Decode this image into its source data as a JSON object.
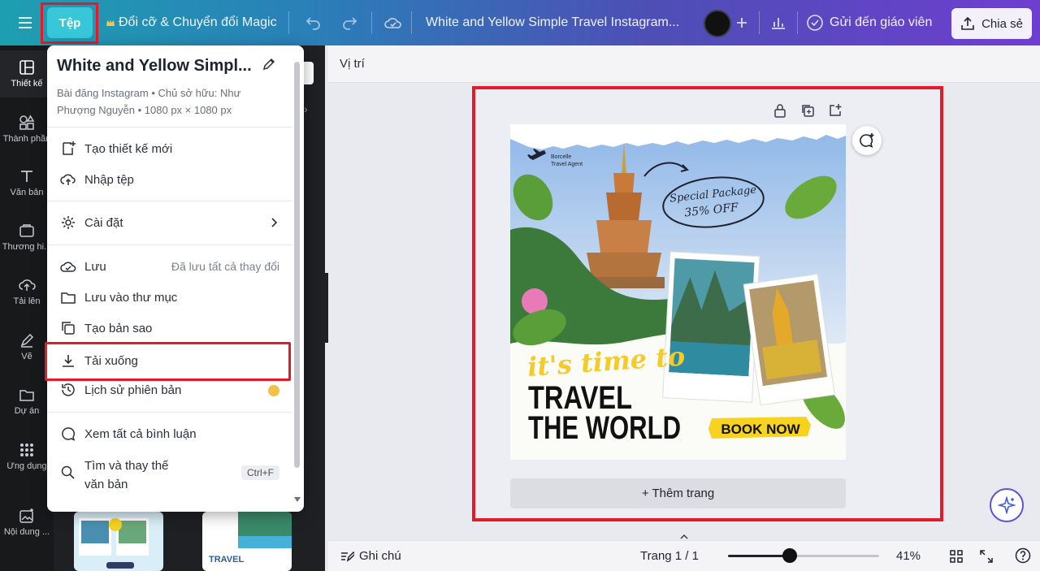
{
  "topbar": {
    "menu_icon": "hamburger-icon",
    "file_label": "Tệp",
    "resize_label": "Đổi cỡ & Chuyển đổi Magic",
    "undo_icon": "undo-icon",
    "redo_icon": "redo-icon",
    "cloud_icon": "cloud-check-icon",
    "design_title": "White and Yellow Simple Travel Instagram...",
    "send_teacher_label": "Gửi đến giáo viên",
    "share_label": "Chia sẻ"
  },
  "rail": [
    {
      "label": "Thiết kế",
      "icon": "layout-icon"
    },
    {
      "label": "Thành phần",
      "icon": "shapes-icon"
    },
    {
      "label": "Văn bản",
      "icon": "text-icon"
    },
    {
      "label": "Thương hi...",
      "icon": "brand-icon"
    },
    {
      "label": "Tải lên",
      "icon": "upload-icon"
    },
    {
      "label": "Vẽ",
      "icon": "draw-icon"
    },
    {
      "label": "Dự án",
      "icon": "folder-icon"
    },
    {
      "label": "Ứng dụng",
      "icon": "apps-icon"
    },
    {
      "label": "Nội dung ...",
      "icon": "magic-media-icon"
    }
  ],
  "file_menu": {
    "title": "White and Yellow Simpl...",
    "meta_line1": "Bài đăng Instagram • Chủ sở hữu: Như",
    "meta_line2": "Phượng Nguyễn • 1080 px × 1080 px",
    "items": [
      {
        "label": "Tạo thiết kế mới",
        "icon": "add-design-icon"
      },
      {
        "label": "Nhập tệp",
        "icon": "import-icon"
      },
      {
        "label": "Cài đặt",
        "icon": "settings-icon"
      },
      {
        "label": "Lưu",
        "icon": "cloud-save-icon",
        "status": "Đã lưu tất cả thay đổi"
      },
      {
        "label": "Lưu vào thư mục",
        "icon": "folder-icon"
      },
      {
        "label": "Tạo bản sao",
        "icon": "copy-icon"
      },
      {
        "label": "Tải xuống",
        "icon": "download-icon"
      },
      {
        "label": "Lịch sử phiên bản",
        "icon": "history-icon"
      },
      {
        "label": "Xem tất cả bình luận",
        "icon": "comment-icon"
      },
      {
        "label": "Tìm và thay thế",
        "label2": "văn bản",
        "icon": "search-icon",
        "shortcut": "Ctrl+F"
      }
    ]
  },
  "editor": {
    "position_label": "Vị trí",
    "add_page_label": "+ Thêm trang"
  },
  "design": {
    "brand_line1": "Borcelle",
    "brand_line2": "Travel Agent",
    "badge_line1": "Special Package",
    "badge_line2": "35% OFF",
    "script_text": "it's time to",
    "headline_line1": "TRAVEL",
    "headline_line2": "THE WORLD",
    "cta": "BOOK NOW"
  },
  "bottombar": {
    "notes_label": "Ghi chú",
    "page_indicator": "Trang 1 / 1",
    "zoom": "41%",
    "zoom_fraction": 0.41
  },
  "colors": {
    "highlight": "#e21a2a",
    "file_button": "#37c7d9",
    "cta_yellow": "#f7d21e"
  }
}
